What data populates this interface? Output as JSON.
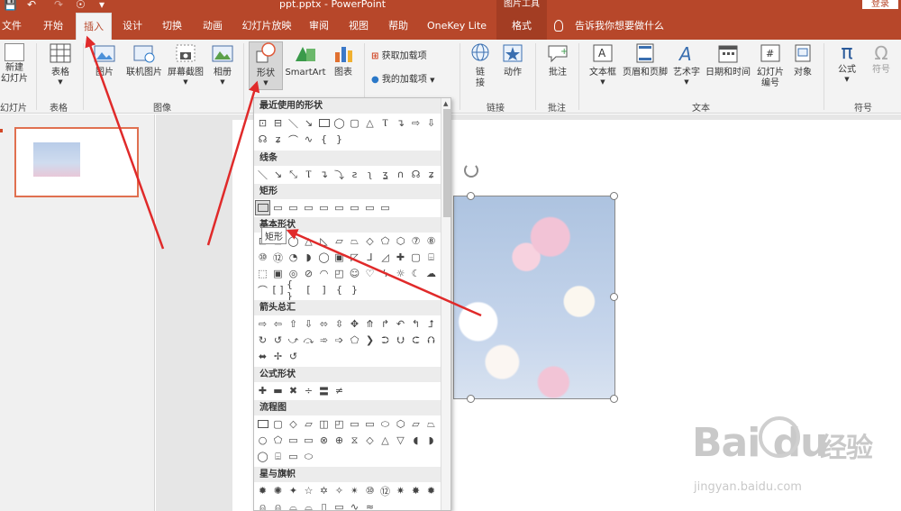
{
  "titlebar": {
    "title": "ppt.pptx - PowerPoint",
    "context_tab": "图片工具",
    "login": "登录"
  },
  "tabs": [
    {
      "label": "文件"
    },
    {
      "label": "开始"
    },
    {
      "label": "插入"
    },
    {
      "label": "设计"
    },
    {
      "label": "切换"
    },
    {
      "label": "动画"
    },
    {
      "label": "幻灯片放映"
    },
    {
      "label": "审阅"
    },
    {
      "label": "视图"
    },
    {
      "label": "帮助"
    },
    {
      "label": "OneKey Lite"
    },
    {
      "label": "格式"
    }
  ],
  "tell_me": "告诉我你想要做什么",
  "ribbon": {
    "buttons": {
      "new_slide_1": "新建",
      "new_slide_2": "幻灯片",
      "table": "表格",
      "picture": "图片",
      "online_picture": "联机图片",
      "screenshot": "屏幕截图",
      "album": "相册",
      "shapes": "形状",
      "smartart": "SmartArt",
      "chart": "图表",
      "get_addins": "获取加载项",
      "my_addins": "我的加载项",
      "link_1": "链",
      "link_2": "接",
      "action": "动作",
      "comment": "批注",
      "textbox": "文本框",
      "header_footer": "页眉和页脚",
      "wordart": "艺术字",
      "datetime": "日期和时间",
      "slide_number_1": "幻灯片",
      "slide_number_2": "编号",
      "object": "对象",
      "equation": "公式",
      "symbol": "符号"
    },
    "groups": {
      "slides": "幻灯片",
      "tables": "表格",
      "images": "图像",
      "links": "链接",
      "comments": "批注",
      "text": "文本",
      "symbols": "符号"
    }
  },
  "shapes_panel": {
    "sections": {
      "recent": "最近使用的形状",
      "lines": "线条",
      "rectangles": "矩形",
      "basic": "基本形状",
      "arrows": "箭头总汇",
      "equation": "公式形状",
      "flowchart": "流程图",
      "stars": "星与旗帜"
    },
    "tooltip": "矩形"
  },
  "watermark": {
    "brand": "Bai du",
    "chinese": "经验",
    "url": "jingyan.baidu.com"
  }
}
